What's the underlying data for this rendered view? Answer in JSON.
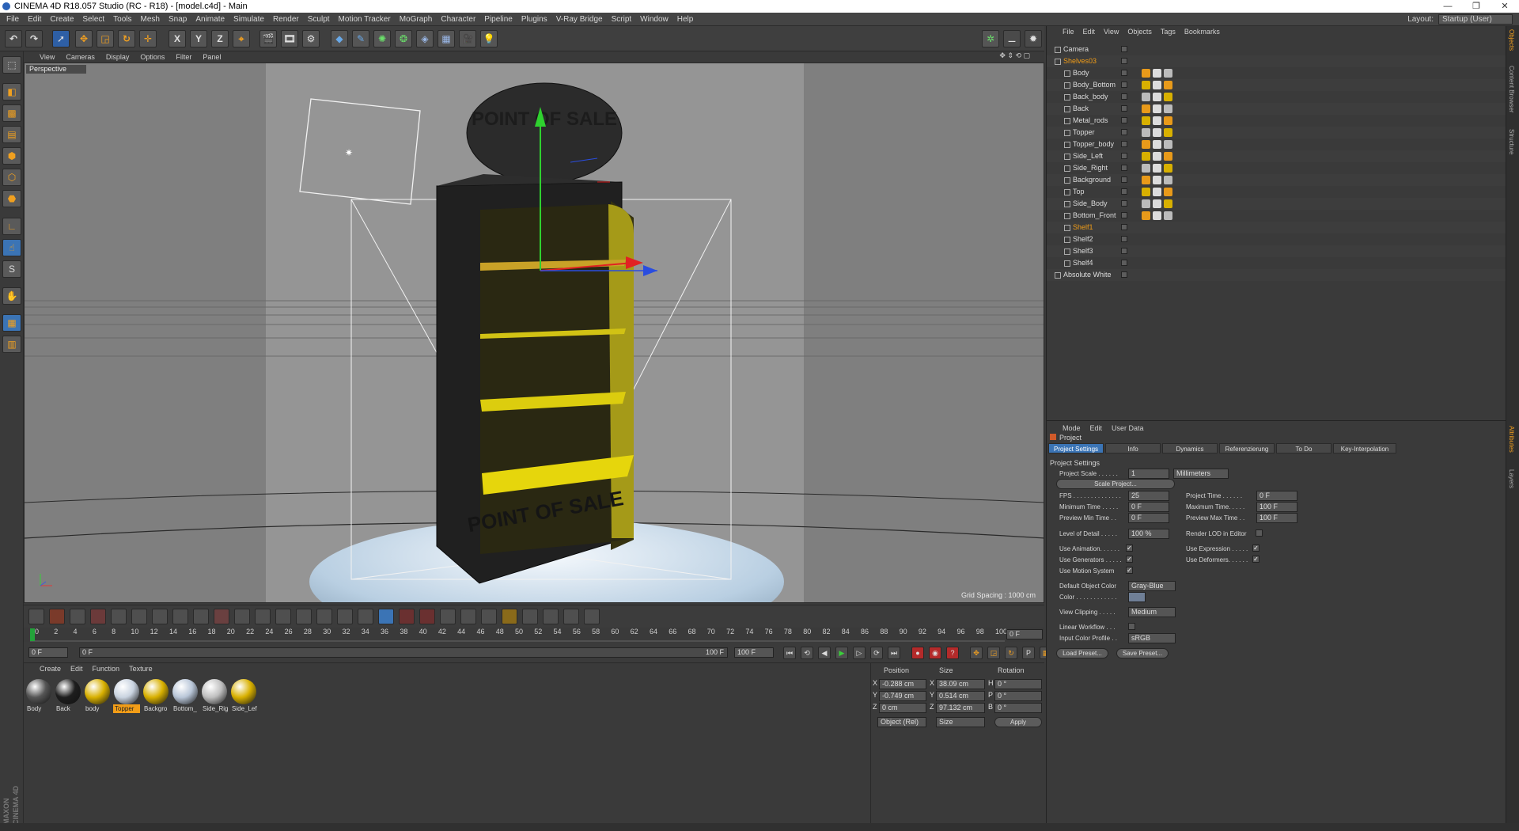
{
  "window": {
    "title": "CINEMA 4D R18.057 Studio (RC - R18) - [model.c4d] - Main",
    "controls": [
      "—",
      "❐",
      "✕"
    ]
  },
  "menu": [
    "File",
    "Edit",
    "Create",
    "Select",
    "Tools",
    "Mesh",
    "Snap",
    "Animate",
    "Simulate",
    "Render",
    "Sculpt",
    "Motion Tracker",
    "MoGraph",
    "Character",
    "Pipeline",
    "Plugins",
    "V-Ray Bridge",
    "Script",
    "Window",
    "Help"
  ],
  "layout": {
    "label": "Layout:",
    "value": "Startup (User)"
  },
  "toolbar": {
    "x_axis": "X",
    "y_axis": "Y",
    "z_axis": "Z"
  },
  "viewport": {
    "menu": [
      "View",
      "Cameras",
      "Display",
      "Options",
      "Filter",
      "Panel"
    ],
    "label": "Perspective",
    "grid_spacing": "Grid Spacing : 1000 cm",
    "sign_top": "POINT OF SALE",
    "sign_bottom": "POINT OF SALE"
  },
  "timeline": {
    "ticks": [
      "0",
      "2",
      "4",
      "6",
      "8",
      "10",
      "12",
      "14",
      "16",
      "18",
      "20",
      "22",
      "24",
      "26",
      "28",
      "30",
      "32",
      "34",
      "36",
      "38",
      "40",
      "42",
      "44",
      "46",
      "48",
      "50",
      "52",
      "54",
      "56",
      "58",
      "60",
      "62",
      "64",
      "66",
      "68",
      "70",
      "72",
      "74",
      "76",
      "78",
      "80",
      "82",
      "84",
      "86",
      "88",
      "90",
      "92",
      "94",
      "96",
      "98",
      "100"
    ],
    "end_field": "0 F",
    "current": "0 F",
    "start": "0 F",
    "slider_end": "100 F",
    "end": "100 F"
  },
  "materials": {
    "menu": [
      "Create",
      "Edit",
      "Function",
      "Texture"
    ],
    "items": [
      {
        "name": "Body",
        "color": "#555555"
      },
      {
        "name": "Back",
        "color": "#1e1e1e"
      },
      {
        "name": "body",
        "color": "#d8b000"
      },
      {
        "name": "Topper",
        "color": "#c9d3e0",
        "selected": true
      },
      {
        "name": "Backgro",
        "color": "#d8b000"
      },
      {
        "name": "Bottom_",
        "color": "#b9c6d8"
      },
      {
        "name": "Side_Rig",
        "color": "#bfbfbf"
      },
      {
        "name": "Side_Lef",
        "color": "#d8b000"
      }
    ]
  },
  "coords": {
    "headers": {
      "position": "Position",
      "size": "Size",
      "rotation": "Rotation"
    },
    "rows": [
      {
        "axis": "X",
        "pos": "-0.288 cm",
        "size_axis": "X",
        "size": "38.09 cm",
        "rot_axis": "H",
        "rot": "0 °"
      },
      {
        "axis": "Y",
        "pos": "-0.749 cm",
        "size_axis": "Y",
        "size": "0.514 cm",
        "rot_axis": "P",
        "rot": "0 °"
      },
      {
        "axis": "Z",
        "pos": "0 cm",
        "size_axis": "Z",
        "size": "97.132 cm",
        "rot_axis": "B",
        "rot": "0 °"
      }
    ],
    "mode": "Object (Rel)",
    "size_mode": "Size",
    "apply": "Apply"
  },
  "objects": {
    "menu": [
      "File",
      "Edit",
      "View",
      "Objects",
      "Tags",
      "Bookmarks"
    ],
    "items": [
      {
        "name": "Camera",
        "indent": 0,
        "orange": false
      },
      {
        "name": "Shelves03",
        "indent": 0,
        "orange": true
      },
      {
        "name": "Body",
        "indent": 1,
        "orange": false
      },
      {
        "name": "Body_Bottom",
        "indent": 1,
        "orange": false
      },
      {
        "name": "Back_body",
        "indent": 1,
        "orange": false
      },
      {
        "name": "Back",
        "indent": 1,
        "orange": false
      },
      {
        "name": "Metal_rods",
        "indent": 1,
        "orange": false
      },
      {
        "name": "Topper",
        "indent": 1,
        "orange": false
      },
      {
        "name": "Topper_body",
        "indent": 1,
        "orange": false
      },
      {
        "name": "Side_Left",
        "indent": 1,
        "orange": false
      },
      {
        "name": "Side_Right",
        "indent": 1,
        "orange": false
      },
      {
        "name": "Background",
        "indent": 1,
        "orange": false
      },
      {
        "name": "Top",
        "indent": 1,
        "orange": false
      },
      {
        "name": "Side_Body",
        "indent": 1,
        "orange": false
      },
      {
        "name": "Bottom_Front",
        "indent": 1,
        "orange": false
      },
      {
        "name": "Shelf1",
        "indent": 1,
        "orange": true
      },
      {
        "name": "Shelf2",
        "indent": 1,
        "orange": false
      },
      {
        "name": "Shelf3",
        "indent": 1,
        "orange": false
      },
      {
        "name": "Shelf4",
        "indent": 1,
        "orange": false
      },
      {
        "name": "Absolute White",
        "indent": 0,
        "orange": false
      }
    ]
  },
  "attributes": {
    "menu": [
      "Mode",
      "Edit",
      "User Data"
    ],
    "object": "Project",
    "tabs": [
      "Project Settings",
      "Info",
      "Dynamics",
      "Referenzierung",
      "To Do",
      "Key-Interpolation"
    ],
    "section": "Project Settings",
    "project_scale_label": "Project Scale . . . . . .",
    "project_scale": "1",
    "project_scale_unit": "Millimeters",
    "scale_button": "Scale Project...",
    "fps_label": "FPS . . . . . . . . . . . . . .",
    "fps": "25",
    "project_time_label": "Project Time . . . . . .",
    "project_time": "0 F",
    "min_time_label": "Minimum Time . . . . .",
    "min_time": "0 F",
    "max_time_label": "Maximum Time. . . . .",
    "max_time": "100 F",
    "prev_min_label": "Preview Min Time . .",
    "prev_min": "0 F",
    "prev_max_label": "Preview Max Time . .",
    "prev_max": "100 F",
    "lod_label": "Level of Detail . . . . .",
    "lod": "100 %",
    "render_lod_label": "Render LOD in Editor",
    "use_anim_label": "Use Animation. . . . . .",
    "use_expr_label": "Use Expression . . . . .",
    "use_gen_label": "Use Generators . . . . .",
    "use_def_label": "Use Deformers. . . . . .",
    "use_motion_label": "Use Motion System",
    "default_color_label": "Default Object Color",
    "default_color": "Gray-Blue",
    "color_label": "Color . . . . . . . . . . . .",
    "view_clip_label": "View Clipping . . . . .",
    "view_clip": "Medium",
    "linear_label": "Linear Workflow . . .",
    "input_profile_label": "Input Color Profile . .",
    "input_profile": "sRGB",
    "load_preset": "Load Preset...",
    "save_preset": "Save Preset..."
  },
  "side_tabs": [
    "Objects",
    "Content Browser",
    "Structure",
    "Attributes",
    "Layers"
  ],
  "maxon": "MAXON CINEMA 4D"
}
